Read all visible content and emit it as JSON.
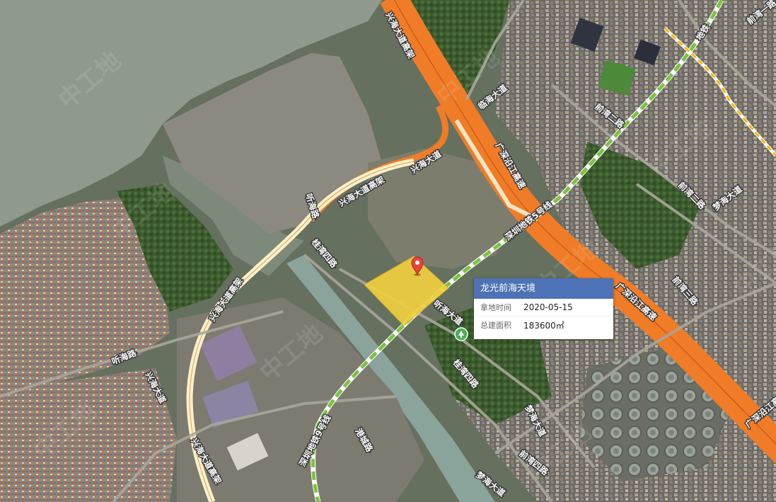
{
  "map": {
    "type": "satellite",
    "road_labels": {
      "xinghai_elevated_top": "兴海大道高架",
      "xinghai_road": "兴海大道",
      "xinghai_elevated_mid": "兴海大道高架",
      "tinghai_road": "听海路",
      "xinghai_elevated_left": "兴海大道高架",
      "xinghai_avenue_lower": "兴海大道",
      "tinghai_road_left": "听海路",
      "xinghai_elevated_bottom": "兴海大道高架",
      "guihai_road_top": "桂湾四路",
      "tinghai_avenue": "听海大道",
      "guihai_road_bottom": "桂湾四路",
      "menghai_avenue": "梦海大道",
      "qianwan_4th": "前湾四路",
      "menghai_avenue_bottom": "梦海大道",
      "gangzhan_road": "港城路",
      "rail_label_lower": "深圳地铁9号线",
      "linhai_avenue": "临海大道",
      "qianwan_1st": "前湾一路",
      "qianwan_2nd": "前湾二路",
      "qianwan_3rd": "前湾三路",
      "menghai_avenue_right": "梦海大道",
      "guangshen_top": "广深沿江高速",
      "guangshen_mid": "广深沿江高速",
      "guangshen_right": "广深沿江高速",
      "rail_label_upper": "深圳地铁5号线",
      "qianwan_2nd_right": "前湾二路",
      "rail_label_top": "地铁"
    },
    "watermark": "中工地"
  },
  "marker": {
    "icon": "map-pin-icon",
    "color": "#e8453c"
  },
  "parcel": {
    "fill": "#f1cf3f"
  },
  "popup": {
    "title": "龙光前海天境",
    "rows": [
      {
        "label": "拿地时间",
        "value": "2020-05-15"
      },
      {
        "label": "总建面积",
        "value": "183600㎡"
      }
    ]
  },
  "colors": {
    "expressway": "#f07c27",
    "elevated_road": "#fff0c8",
    "metro_line": "#7cc242",
    "metro_line_yellow": "#f5b800",
    "popup_header": "#4d73b6"
  }
}
